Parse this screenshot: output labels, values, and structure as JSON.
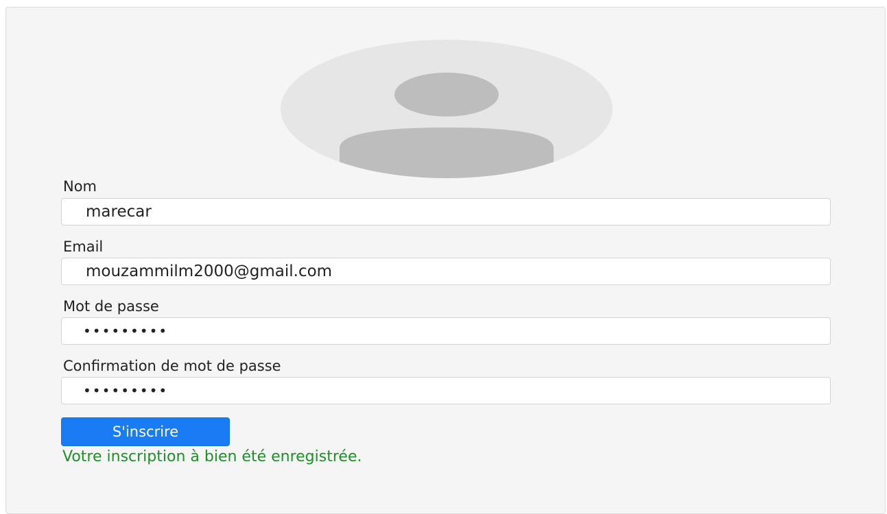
{
  "form": {
    "avatar_icon": "user-placeholder-icon",
    "name": {
      "label": "Nom",
      "value": "marecar"
    },
    "email": {
      "label": "Email",
      "value": "mouzammilm2000@gmail.com"
    },
    "password": {
      "label": "Mot de passe",
      "value": "•••••••••"
    },
    "password_confirm": {
      "label": "Confirmation de mot de passe",
      "value": "•••••••••"
    },
    "submit_label": "S'inscrire",
    "success_message": "Votre inscription à bien été enregistrée."
  },
  "colors": {
    "primary": "#1a7cf5",
    "success": "#1f8f2a",
    "avatar_bg": "#e6e6e6",
    "avatar_fg": "#bdbdbd"
  }
}
